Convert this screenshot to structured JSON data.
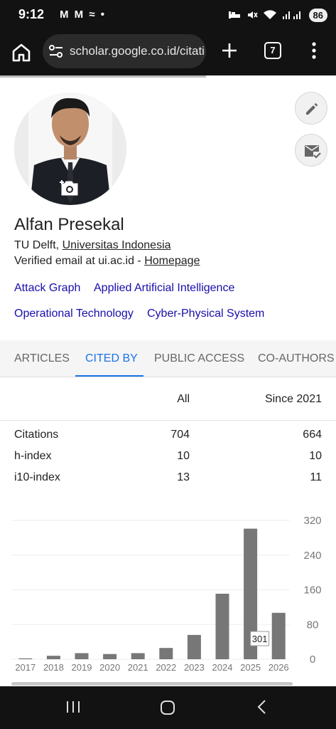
{
  "status": {
    "time": "9:12",
    "left_icons": "M M ≈ •",
    "battery": "86"
  },
  "browser": {
    "url": "scholar.google.co.id/citati",
    "tab_count": "7"
  },
  "profile": {
    "name": "Alfan Presekal",
    "affiliation_prefix": "TU Delft, ",
    "affiliation_link": "Universitas Indonesia",
    "email_prefix": "Verified email at ui.ac.id - ",
    "homepage_link": "Homepage",
    "interests": [
      "Attack Graph",
      "Applied Artificial Intelligence",
      "Operational Technology",
      "Cyber-Physical System"
    ]
  },
  "tabs": [
    "ARTICLES",
    "CITED BY",
    "PUBLIC ACCESS",
    "CO-AUTHORS"
  ],
  "active_tab": "CITED BY",
  "stats": {
    "headers": {
      "all": "All",
      "since": "Since 2021"
    },
    "rows": [
      {
        "label": "Citations",
        "all": "704",
        "since": "664"
      },
      {
        "label": "h-index",
        "all": "10",
        "since": "10"
      },
      {
        "label": "i10-index",
        "all": "13",
        "since": "11"
      }
    ]
  },
  "chart_data": {
    "type": "bar",
    "categories": [
      "2017",
      "2018",
      "2019",
      "2020",
      "2021",
      "2022",
      "2023",
      "2024",
      "2025",
      "2026"
    ],
    "values": [
      2,
      8,
      14,
      12,
      14,
      26,
      56,
      151,
      301,
      107
    ],
    "yticks": [
      "320",
      "240",
      "160",
      "80",
      "0"
    ],
    "ylim": [
      0,
      320
    ],
    "tooltip": "301",
    "bar_color": "#777777"
  }
}
